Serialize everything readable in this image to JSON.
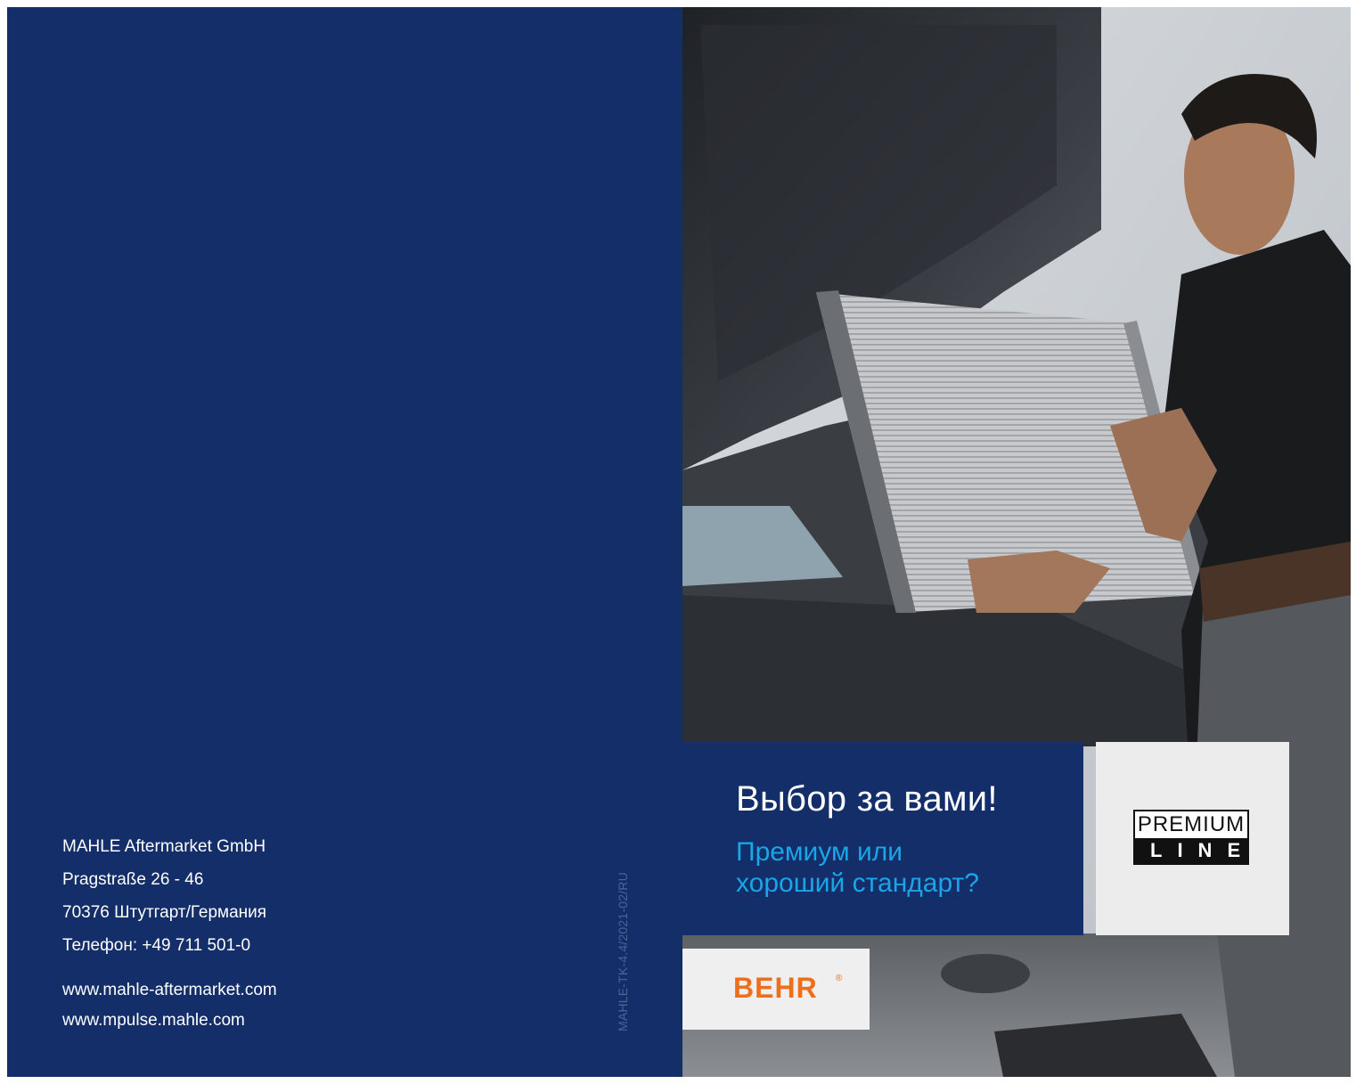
{
  "address": {
    "company": "MAHLE Aftermarket GmbH",
    "street": "Pragstraße 26 - 46",
    "city": "70376 Штутгарт/Германия",
    "phone": "Телефон: +49 711 501-0"
  },
  "web": {
    "site1": "www.mahle-aftermarket.com",
    "site2": "www.mpulse.mahle.com"
  },
  "doc_code": "MAHLE-TK-4.4/2021-02/RU",
  "headline": "Выбор за вами!",
  "subline": {
    "line1": "Премиум или",
    "line2": "хороший стандарт?"
  },
  "premium_logo": {
    "top": "PREMIUM",
    "bottom": "LINE"
  },
  "behr_logo": {
    "text": "BEHR",
    "reg": "®"
  },
  "colors": {
    "navy": "#132e69",
    "accent_blue": "#1aa5e6",
    "behr_orange": "#ee6e1b"
  }
}
